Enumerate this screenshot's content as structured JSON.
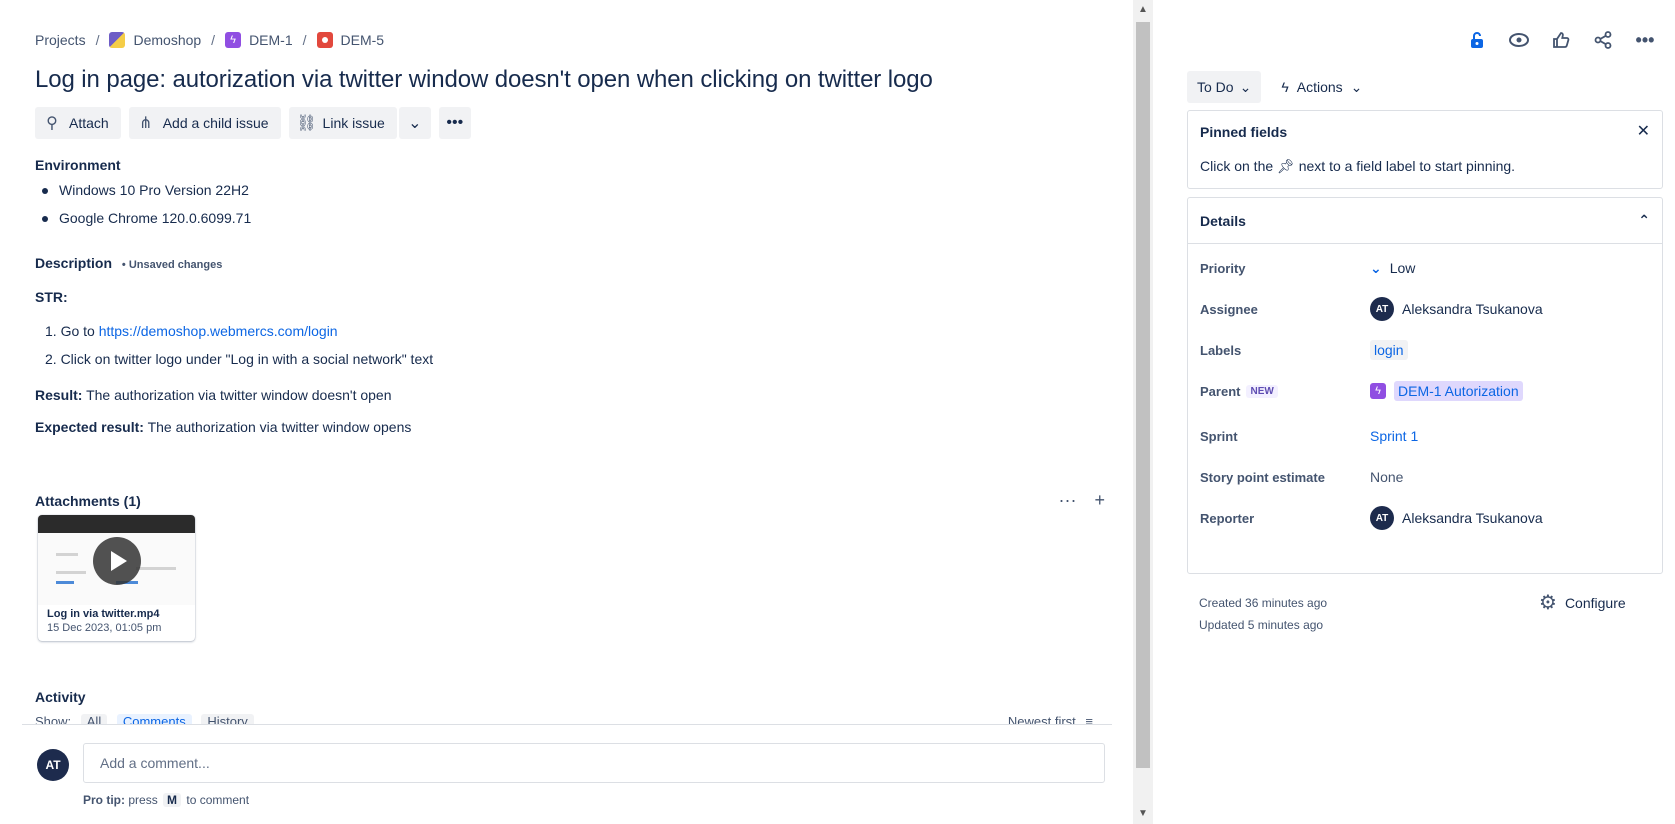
{
  "breadcrumb": {
    "projects": "Projects",
    "project": "Demoshop",
    "epic": "DEM-1",
    "issue": "DEM-5",
    "sep": "/"
  },
  "title": "Log in page: autorization via twitter window doesn't open when clicking on twitter logo",
  "toolbar": {
    "attach": "Attach",
    "add_child": "Add a child issue",
    "link_issue": "Link issue"
  },
  "environment": {
    "label": "Environment",
    "items": [
      "Windows 10 Pro Version 22H2",
      "Google Chrome 120.0.6099.71"
    ]
  },
  "description": {
    "label": "Description",
    "unsaved": "• Unsaved changes",
    "str": "STR:",
    "step1_prefix": "1. Go to ",
    "step1_link": "https://demoshop.webmercs.com/login",
    "step2": "2. Click on twitter logo under \"Log in with a social network\" text",
    "result_label": "Result:",
    "result_text": " The authorization via twitter window doesn't open",
    "expected_label": "Expected result:",
    "expected_text": " The authorization via twitter window opens"
  },
  "attachments": {
    "label": "Attachments (1)",
    "file_name": "Log in via twitter.mp4",
    "file_date": "15 Dec 2023, 01:05 pm"
  },
  "activity": {
    "label": "Activity",
    "show": "Show:",
    "all": "All",
    "comments": "Comments",
    "history": "History",
    "sort": "Newest first"
  },
  "comment": {
    "avatar": "AT",
    "placeholder": "Add a comment...",
    "tip_label": "Pro tip:",
    "tip_press": "press",
    "tip_key": "M",
    "tip_suffix": "to comment"
  },
  "sidebar": {
    "status": "To Do",
    "actions": "Actions",
    "pinned_title": "Pinned fields",
    "pinned_text_a": "Click on the",
    "pinned_text_b": "next to a field label to start pinning.",
    "details_title": "Details",
    "fields": {
      "priority_label": "Priority",
      "priority_value": "Low",
      "assignee_label": "Assignee",
      "assignee_value": "Aleksandra Tsukanova",
      "labels_label": "Labels",
      "labels_value": "login",
      "parent_label": "Parent",
      "parent_badge": "NEW",
      "parent_value": "DEM-1 Autorization",
      "sprint_label": "Sprint",
      "sprint_value": "Sprint 1",
      "sp_label": "Story point estimate",
      "sp_value": "None",
      "reporter_label": "Reporter",
      "reporter_value": "Aleksandra Tsukanova",
      "avatar_initials": "AT"
    },
    "created": "Created 36 minutes ago",
    "updated": "Updated 5 minutes ago",
    "configure": "Configure"
  }
}
